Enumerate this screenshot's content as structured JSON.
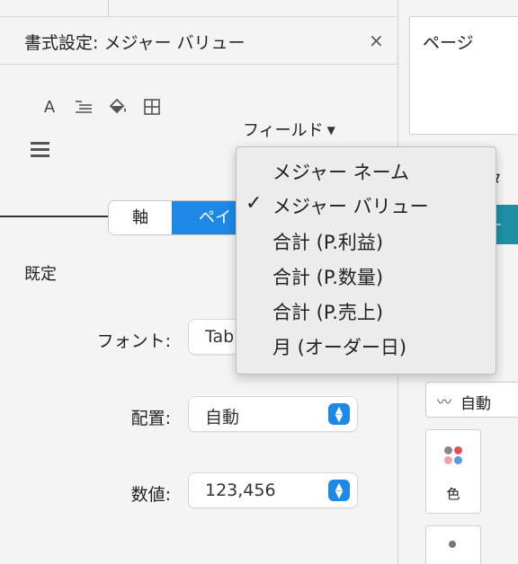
{
  "format_pane": {
    "title": "書式設定: メジャー バリュー",
    "close_glyph": "×",
    "toolbar": {
      "font_icon_glyph": "A"
    },
    "field_dropdown_label": "フィールド",
    "segmented": {
      "axis_label": "軸",
      "pane_label": "ペイ"
    },
    "section_label": "既定",
    "rows": {
      "font_label": "フォント:",
      "font_value": "Tab",
      "alignment_label": "配置:",
      "alignment_value": "自動",
      "numbers_label": "数値:",
      "numbers_value": "123,456"
    }
  },
  "right_pane": {
    "pages_label": "ページ",
    "partial_text": "タ",
    "teal_partial": "ー",
    "marks_type_label": "自動",
    "color_card_label": "色"
  },
  "menu": {
    "items": [
      {
        "label": "メジャー ネーム",
        "checked": false
      },
      {
        "label": "メジャー バリュー",
        "checked": true
      },
      {
        "label": "合計 (P.利益)",
        "checked": false
      },
      {
        "label": "合計 (P.数量)",
        "checked": false
      },
      {
        "label": "合計 (P.売上)",
        "checked": false
      },
      {
        "label": "月 (オーダー日)",
        "checked": false
      }
    ],
    "check_glyph": "✓"
  },
  "colors": {
    "accent": "#1e88e5",
    "teal": "#1f8fa5"
  }
}
